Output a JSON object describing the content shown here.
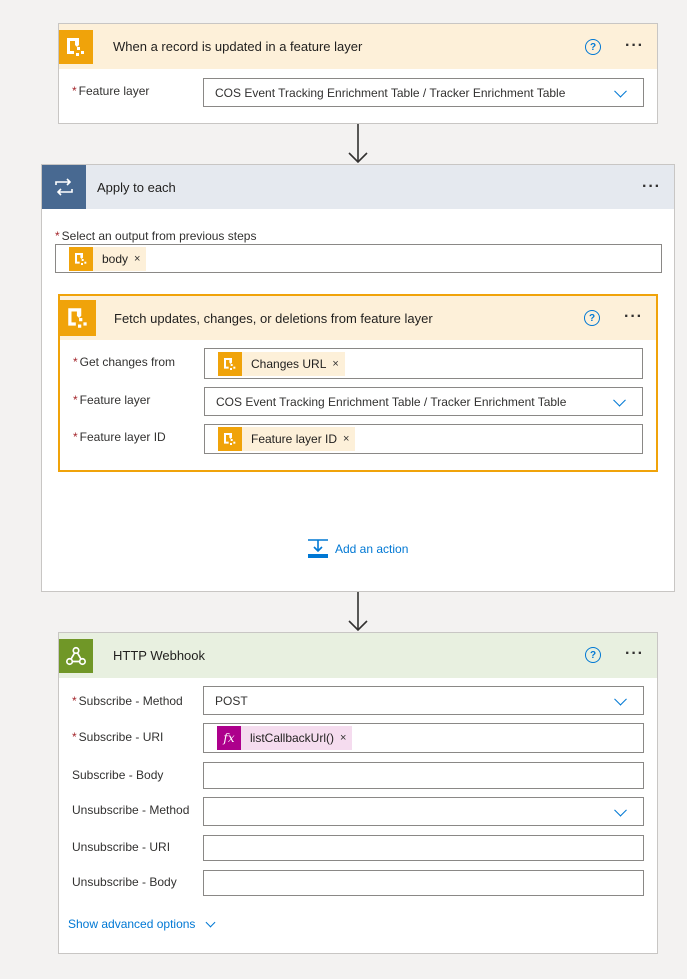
{
  "trigger": {
    "title": "When a record is updated in a feature layer",
    "icon": "arcgis-icon",
    "fields": [
      {
        "label": "Feature layer",
        "required": true,
        "value": "COS Event Tracking Enrichment Table / Tracker Enrichment Table",
        "type": "dropdown"
      }
    ]
  },
  "loop": {
    "title": "Apply to each",
    "icon": "loop-icon",
    "select_label": "Select an output from previous steps",
    "select_token": "body",
    "add_action": "Add an action",
    "inner": {
      "title": "Fetch updates, changes, or deletions from feature layer",
      "fields": [
        {
          "label": "Get changes from",
          "required": true,
          "token": "Changes URL"
        },
        {
          "label": "Feature layer",
          "required": true,
          "value": "COS Event Tracking Enrichment Table / Tracker Enrichment Table"
        },
        {
          "label": "Feature layer ID",
          "required": true,
          "token": "Feature layer ID"
        }
      ]
    }
  },
  "webhook": {
    "title": "HTTP Webhook",
    "icon": "webhook-icon",
    "fields": [
      {
        "label": "Subscribe - Method",
        "required": true,
        "value": "POST"
      },
      {
        "label": "Subscribe - URI",
        "required": true,
        "token": "listCallbackUrl()"
      },
      {
        "label": "Subscribe - Body",
        "required": false,
        "value": ""
      },
      {
        "label": "Unsubscribe - Method",
        "required": false,
        "value": ""
      },
      {
        "label": "Unsubscribe - URI",
        "required": false,
        "value": ""
      },
      {
        "label": "Unsubscribe - Body",
        "required": false,
        "value": ""
      }
    ],
    "advanced": "Show advanced options"
  },
  "common": {
    "more": "···",
    "help": "?",
    "remove": "×",
    "required_mark": "*",
    "fx": "fx"
  },
  "colors": {
    "arcgis": "#f0a30a",
    "arcgis_header": "#fdf0d9",
    "loop": "#486991",
    "loop_header": "#e5e9ef",
    "webhook": "#709727",
    "webhook_header": "#e8f0e0",
    "fx": "#ad008c",
    "accent": "#0078d4"
  }
}
